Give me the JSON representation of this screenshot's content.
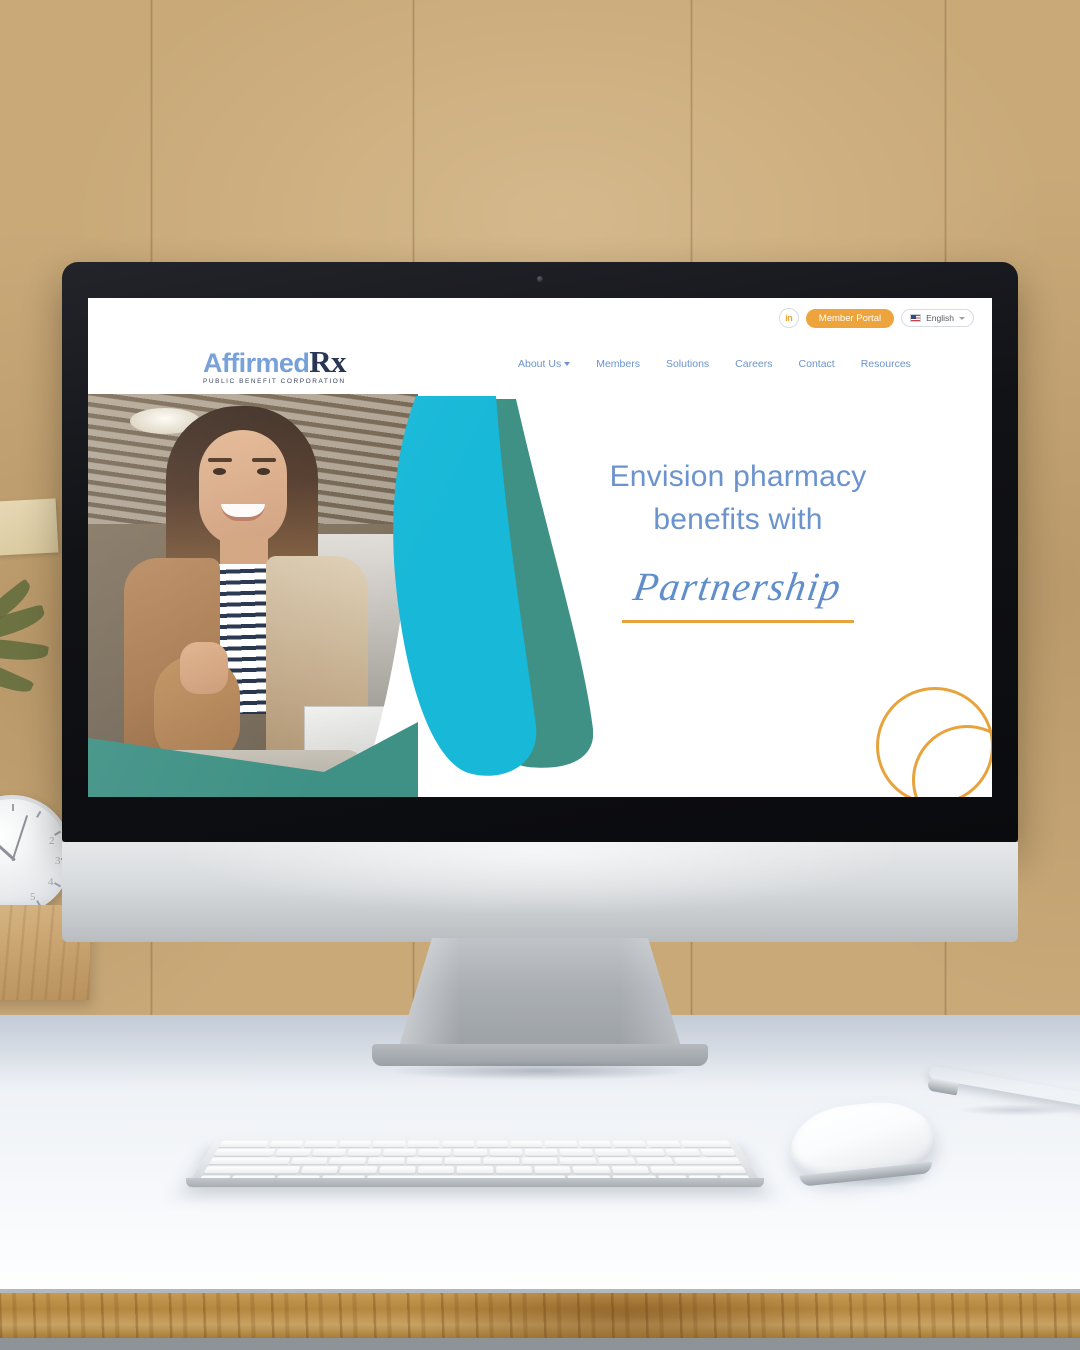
{
  "scene": {
    "description": "Desktop computer on white desk against wooden wall",
    "props": [
      "wall-clock",
      "wooden-block",
      "plant",
      "sticky-note",
      "keyboard",
      "mouse",
      "pen"
    ]
  },
  "site": {
    "utility": {
      "linkedin_label": "in",
      "member_portal_label": "Member Portal",
      "language_label": "English"
    },
    "logo": {
      "name_main": "Affirmed",
      "name_rx": "Rx",
      "tagline": "PUBLIC BENEFIT CORPORATION"
    },
    "nav": [
      {
        "label": "About Us",
        "has_dropdown": true
      },
      {
        "label": "Members",
        "has_dropdown": false
      },
      {
        "label": "Solutions",
        "has_dropdown": false
      },
      {
        "label": "Careers",
        "has_dropdown": false
      },
      {
        "label": "Contact",
        "has_dropdown": false
      },
      {
        "label": "Resources",
        "has_dropdown": false
      }
    ],
    "hero": {
      "heading_line1": "Envision pharmacy",
      "heading_line2": "benefits with",
      "script_word": "Partnership",
      "image_alt": "Smiling woman with laptop holding a glass"
    }
  },
  "colors": {
    "brand_blue": "#6b93cd",
    "brand_navy": "#1c2a4a",
    "accent_orange": "#eda43c",
    "underline_orange": "#e8a33d",
    "shape_cyan": "#17b8d8",
    "shape_teal": "#3f9185",
    "screen_bg": "#ffffff",
    "bezel": "#0a0b0e",
    "chassis_silver": "#d6d9dc",
    "wall_wood": "#c5a473",
    "desk_white": "#f6f8fb"
  }
}
